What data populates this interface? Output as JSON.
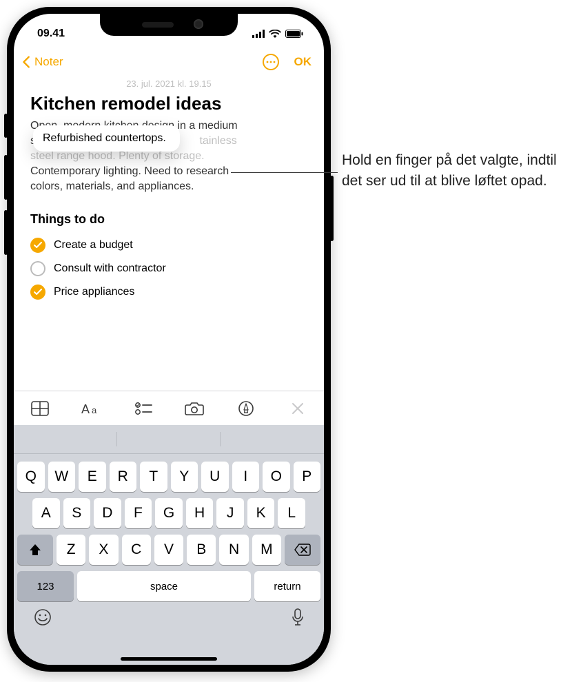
{
  "status": {
    "time": "09.41"
  },
  "nav": {
    "back": "Noter",
    "ok": "OK"
  },
  "note": {
    "date": "23. jul. 2021 kl. 19.15",
    "title": "Kitchen remodel ideas",
    "body_line1_a": "Open, modern kitchen design in a medium",
    "body_line2_a": "space.",
    "body_line2_b": "tainless",
    "body_line3": "steel range hood. Plenty of storage.",
    "body_line4": "Contemporary lighting. Need to research",
    "body_line5": "colors, materials, and appliances.",
    "lifted": "Refurbished countertops.",
    "sub": "Things to do",
    "todos": [
      {
        "label": "Create a budget",
        "done": true
      },
      {
        "label": "Consult with contractor",
        "done": false
      },
      {
        "label": "Price appliances",
        "done": true
      }
    ]
  },
  "keyboard": {
    "predictions": [
      "",
      "",
      ""
    ],
    "row1": [
      "Q",
      "W",
      "E",
      "R",
      "T",
      "Y",
      "U",
      "I",
      "O",
      "P"
    ],
    "row2": [
      "A",
      "S",
      "D",
      "F",
      "G",
      "H",
      "J",
      "K",
      "L"
    ],
    "row3": [
      "Z",
      "X",
      "C",
      "V",
      "B",
      "N",
      "M"
    ],
    "numbers": "123",
    "space": "space",
    "return": "return"
  },
  "callout": "Hold en finger på det valgte, indtil det ser ud til at blive løftet opad."
}
